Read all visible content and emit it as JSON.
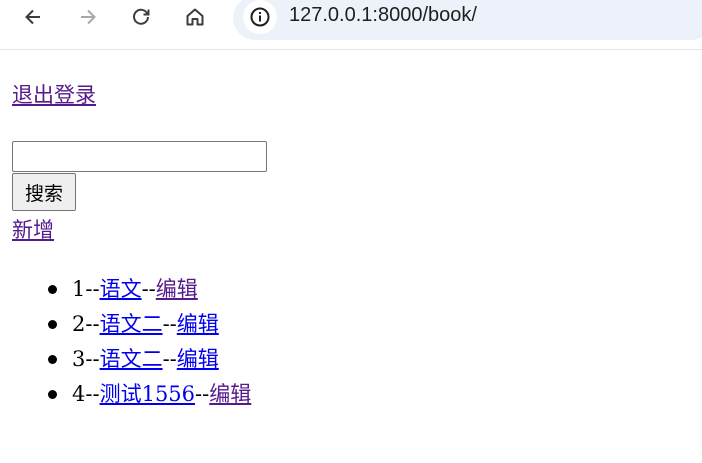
{
  "browser": {
    "url": "127.0.0.1:8000/book/",
    "back_icon": "arrow-left-icon",
    "forward_icon": "arrow-right-icon",
    "reload_icon": "reload-icon",
    "home_icon": "home-icon",
    "site_info_icon": "info-icon"
  },
  "page": {
    "logout_label": "退出登录",
    "search": {
      "value": "",
      "placeholder": "",
      "button_label": "搜索"
    },
    "add_label": "新增",
    "separator": "--",
    "books": [
      {
        "id": "1",
        "title": "语文",
        "edit_label": "编辑"
      },
      {
        "id": "2",
        "title": "语文二",
        "edit_label": "编辑"
      },
      {
        "id": "3",
        "title": "语文二",
        "edit_label": "编辑"
      },
      {
        "id": "4",
        "title": "测试1556",
        "edit_label": "编辑"
      }
    ]
  },
  "colors": {
    "link_visited": "#551a8b",
    "link_unvisited": "#0000ee",
    "omnibox_bg": "#edf2fa"
  }
}
